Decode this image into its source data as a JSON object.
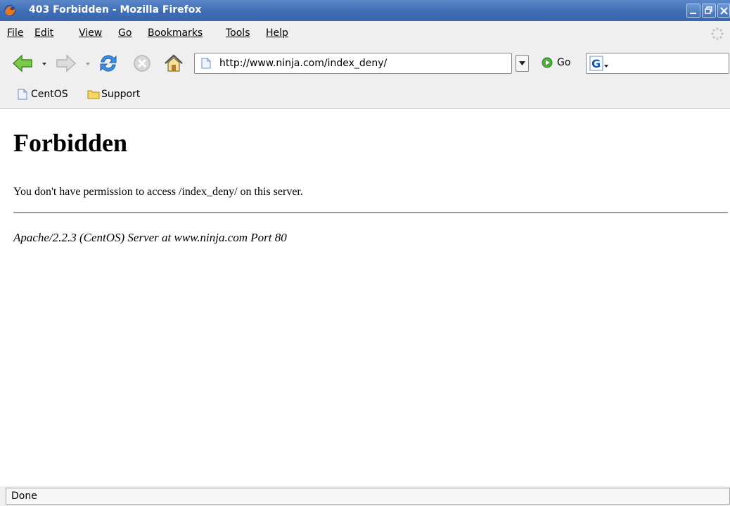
{
  "window": {
    "title": "403 Forbidden - Mozilla Firefox",
    "title_bar_color": "#3f6db5"
  },
  "menu": {
    "items": [
      {
        "label": "File",
        "icon": null
      },
      {
        "label": "Edit"
      },
      {
        "label": "View"
      },
      {
        "label": "Go"
      },
      {
        "label": "Bookmarks"
      },
      {
        "label": "Tools"
      },
      {
        "label": "Help"
      }
    ]
  },
  "toolbar": {
    "back_icon": "back-arrow-icon",
    "forward_icon": "forward-arrow-icon",
    "reload_icon": "reload-icon",
    "stop_icon": "stop-icon",
    "home_icon": "home-icon",
    "url": "http://www.ninja.com/index_deny/",
    "go_label": "Go",
    "search_value": ""
  },
  "bookmarks": {
    "items": [
      {
        "label": "CentOS",
        "icon": "page-icon"
      },
      {
        "label": "Support",
        "icon": "folder-icon"
      }
    ]
  },
  "page": {
    "heading": "Forbidden",
    "message": "You don't have permission to access /index_deny/ on this server.",
    "server_signature": "Apache/2.2.3 (CentOS) Server at www.ninja.com Port 80"
  },
  "status": {
    "text": "Done"
  }
}
